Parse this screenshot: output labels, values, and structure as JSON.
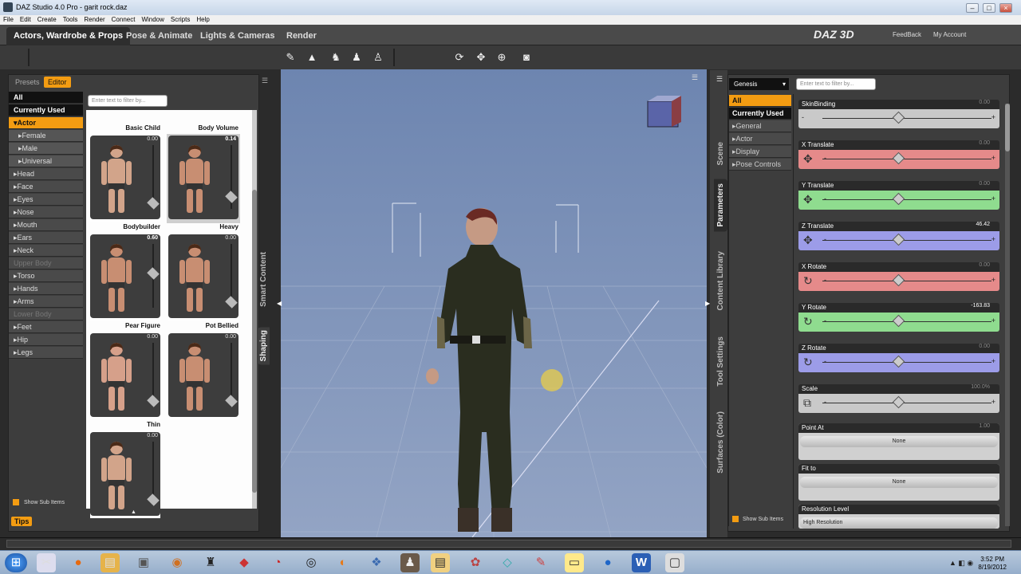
{
  "window": {
    "title": "DAZ Studio 4.0 Pro - garit rock.daz"
  },
  "menu": [
    "File",
    "Edit",
    "Create",
    "Tools",
    "Render",
    "Connect",
    "Window",
    "Scripts",
    "Help"
  ],
  "rooms": [
    "Actors, Wardrobe & Props",
    "Pose & Animate",
    "Lights & Cameras",
    "Render"
  ],
  "brand": {
    "logo": "DAZ 3D",
    "feedback": "FeedBack",
    "account": "My Account"
  },
  "toolbar_icons": [
    "figure-setup-icon",
    "landscape-icon",
    "people-icon",
    "pose-icon",
    "group-icon",
    "rotate-icon",
    "move-icon",
    "orbit-icon",
    "camera-icon"
  ],
  "left": {
    "tabs": {
      "presets": "Presets",
      "editor": "Editor"
    },
    "filter_placeholder": "Enter text to filter by...",
    "categories": [
      {
        "label": "All",
        "style": "black"
      },
      {
        "label": "Currently Used",
        "style": "black"
      },
      {
        "label": "▾Actor",
        "style": "orange"
      },
      {
        "label": "▸Female",
        "style": "sub"
      },
      {
        "label": "▸Male",
        "style": "sub"
      },
      {
        "label": "▸Universal",
        "style": "sub"
      },
      {
        "label": "▸Head",
        "style": ""
      },
      {
        "label": "▸Face",
        "style": ""
      },
      {
        "label": "▸Eyes",
        "style": ""
      },
      {
        "label": "▸Nose",
        "style": ""
      },
      {
        "label": "▸Mouth",
        "style": ""
      },
      {
        "label": "▸Ears",
        "style": ""
      },
      {
        "label": "▸Neck",
        "style": ""
      },
      {
        "label": "Upper Body",
        "style": "dim"
      },
      {
        "label": "▸Torso",
        "style": ""
      },
      {
        "label": "▸Hands",
        "style": ""
      },
      {
        "label": "▸Arms",
        "style": ""
      },
      {
        "label": "Lower Body",
        "style": "dim"
      },
      {
        "label": "▸Feet",
        "style": ""
      },
      {
        "label": "▸Hip",
        "style": ""
      },
      {
        "label": "▸Legs",
        "style": ""
      }
    ],
    "morphs": [
      {
        "name": "Basic Child",
        "value": "0.00"
      },
      {
        "name": "Body Volume",
        "value": "0.14"
      },
      {
        "name": "Bodybuilder",
        "value": "0.60"
      },
      {
        "name": "Heavy",
        "value": "0.00"
      },
      {
        "name": "Pear Figure",
        "value": "0.00"
      },
      {
        "name": "Pot Bellied",
        "value": "0.00"
      },
      {
        "name": "Thin",
        "value": "0.00"
      }
    ],
    "show_sub_items": "Show Sub Items",
    "tips": "Tips",
    "side_tabs": {
      "smart_content": "Smart Content",
      "shaping": "Shaping"
    }
  },
  "right": {
    "node": "Genesis",
    "filter_placeholder": "Enter text to filter by...",
    "categories": [
      {
        "label": "All",
        "style": "orange"
      },
      {
        "label": "Currently Used",
        "style": "black"
      },
      {
        "label": "▸General",
        "style": ""
      },
      {
        "label": "▸Actor",
        "style": ""
      },
      {
        "label": "▸Display",
        "style": ""
      },
      {
        "label": "▸Pose Controls",
        "style": ""
      }
    ],
    "side_tabs": {
      "scene": "Scene",
      "parameters": "Parameters",
      "content_library": "Content Library",
      "tool_settings": "Tool Settings",
      "surfaces": "Surfaces (Color)"
    },
    "params": [
      {
        "name": "SkinBinding",
        "value": "0.00",
        "color": "#c9c9c9",
        "icon": "",
        "knob": 0.5
      },
      {
        "name": "X Translate",
        "value": "0.00",
        "color": "#e58a8a",
        "icon": "✥",
        "knob": 0.5
      },
      {
        "name": "Y Translate",
        "value": "0.00",
        "color": "#8fdc8f",
        "icon": "✥",
        "knob": 0.5
      },
      {
        "name": "Z Translate",
        "value": "46.42",
        "color": "#9c9ce8",
        "icon": "✥",
        "knob": 0.5
      },
      {
        "name": "X Rotate",
        "value": "0.00",
        "color": "#e58a8a",
        "icon": "↻",
        "knob": 0.5
      },
      {
        "name": "Y Rotate",
        "value": "-163.83",
        "color": "#8fdc8f",
        "icon": "↻",
        "knob": 0.5
      },
      {
        "name": "Z Rotate",
        "value": "0.00",
        "color": "#9c9ce8",
        "icon": "↻",
        "knob": 0.5
      },
      {
        "name": "Scale",
        "value": "100.0%",
        "color": "#c9c9c9",
        "icon": "⧉",
        "knob": 0.5
      }
    ],
    "point_at": {
      "name": "Point At",
      "value": "1.00",
      "button": "None"
    },
    "fit_to": {
      "name": "Fit to",
      "button": "None"
    },
    "resolution": {
      "name": "Resolution Level",
      "value": "High Resolution"
    },
    "show_sub_items": "Show Sub Items"
  },
  "clock": {
    "time": "3:52 PM",
    "date": "8/19/2012"
  }
}
